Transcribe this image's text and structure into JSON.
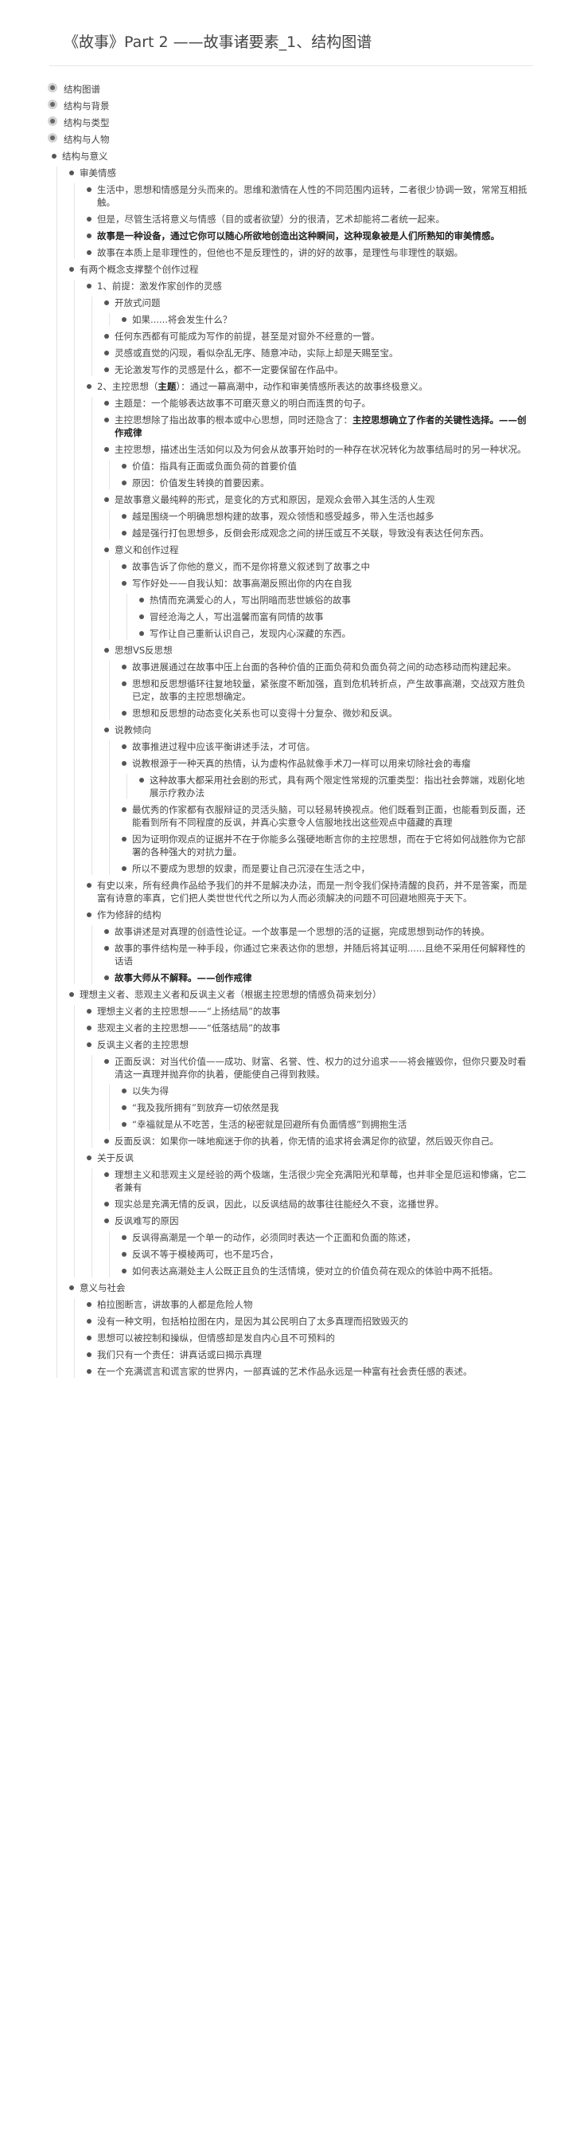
{
  "title": "《故事》Part 2 ——故事诸要素_1、结构图谱",
  "top_items": [
    "结构图谱",
    "结构与背景",
    "结构与类型",
    "结构与人物"
  ],
  "meaning": {
    "label": "结构与意义",
    "aesthetic": {
      "label": "审美情感",
      "items": [
        "生活中，思想和情感是分头而来的。思维和激情在人性的不同范围内运转，二者很少协调一致，常常互相抵触。",
        "但是，尽管生活将意义与情感（目的或者欲望）分的很清，艺术却能将二者统一起来。",
        "故事是一种设备，通过它你可以随心所欲地创造出这种瞬间，这种现象被是人们所熟知的审美情感。",
        "故事在本质上是非理性的，但他也不是反理性的，讲的好的故事，是理性与非理性的联姻。"
      ]
    },
    "two_concepts": {
      "label": "有两个概念支撑整个创作过程",
      "premise": {
        "label": "1、前提：激发作家创作的灵感",
        "open_q": "开放式问题",
        "open_q_sub": "如果......将会发生什么？",
        "items": [
          "任何东西都有可能成为写作的前提，甚至是对窗外不经意的一瞥。",
          "灵感或直觉的闪现，看似杂乱无序、随意冲动，实际上却是天赐至宝。",
          "无论激发写作的灵感是什么，都不一定要保留在作品中。"
        ]
      },
      "controlling": {
        "label_a": "2、主控思想（",
        "label_bold": "主题",
        "label_b": "）：通过一幕高潮中，动作和审美情感所表达的故事终极意义。",
        "p1": "主题是：一个能够表达故事不可磨灭意义的明白而连贯的句子。",
        "p2a": "主控思想除了指出故事的根本或中心思想，同时还隐含了：",
        "p2b": "主控思想确立了作者的关键性选择。——创作戒律",
        "p3": "主控思想，描述出生活如何以及为何会从故事开始时的一种存在状况转化为故事结局时的另一种状况。",
        "p3_sub": [
          "价值：指具有正面或负面负荷的首要价值",
          "原因：价值发生转换的首要因素。"
        ],
        "p4": "是故事意义最纯粹的形式，是变化的方式和原因，是观众会带入其生活的人生观",
        "p4_sub": [
          "越是围绕一个明确思想构建的故事，观众领悟和感受越多，带入生活也越多",
          "越是强行打包思想多，反倒会形成观念之间的拼压或互不关联，导致没有表达任何东西。"
        ],
        "p5": "意义和创作过程",
        "p5_sub": [
          "故事告诉了你他的意义，而不是你将意义叙述到了故事之中",
          "写作好处——自我认知：故事高潮反照出你的内在自我"
        ],
        "p5_sub2": [
          "热情而充满爱心的人，写出阴暗而悲世嫉俗的故事",
          "冒经沧海之人，写出温馨而富有同情的故事",
          "写作让自己重新认识自己，发现内心深藏的东西。"
        ],
        "p6": "思想VS反思想",
        "p6_sub": [
          "故事进展通过在故事中压上台面的各种价值的正面负荷和负面负荷之间的动态移动而构建起来。",
          "思想和反思想循环往复地较量，紧张度不断加强，直到危机转折点，产生故事高潮，交战双方胜负已定，故事的主控思想确定。",
          "思想和反思想的动态变化关系也可以变得十分复杂、微妙和反讽。"
        ],
        "p7": "说教倾向",
        "p7_sub": [
          "故事推进过程中应该平衡讲述手法，才可信。",
          "说教根源于一种天真的热情，认为虚构作品就像手术刀一样可以用来切除社会的毒瘤"
        ],
        "p7_sub2": "这种故事大都采用社会剧的形式，具有两个限定性常规的沉重类型：指出社会弊端，戏剧化地展示疗救办法",
        "p7_sub3": [
          "最优秀的作家都有衣服辩证的灵活头脑，可以轻易转换视点。他们既看到正面，也能看到反面，还能看到所有不同程度的反讽，并真心实意令人信服地找出这些观点中蕴藏的真理",
          "因为证明你观点的证据并不在于你能多么强硬地断言你的主控思想，而在于它将如何战胜你为它部署的各种强大的对抗力量。",
          "所以不要成为思想的奴隶，而是要让自己沉浸在生活之中，"
        ]
      }
    },
    "anxiety": "有史以来，所有经典作品给予我们的并不是解决办法，而是一剂令我们保持清醒的良药，并不是答案，而是富有诗意的率真，它们把人类世世代代之所以为人而必须解决的问题不可回避地照亮于天下。",
    "art": {
      "label": "作为修辞的结构",
      "items": [
        "故事讲述是对真理的创造性论证。一个故事是一个思想的活的证据，完成思想到动作的转换。",
        "故事的事件结构是一种手段，你通过它来表达你的思想，并随后将其证明......且绝不采用任何解释性的话语"
      ],
      "rule": "故事大师从不解释。——创作戒律"
    }
  },
  "idealism": {
    "label": "理想主义者、悲观主义者和反讽主义者（根据主控思想的情感负荷来划分）",
    "items": [
      "理想主义者的主控思想——“上扬结局”的故事",
      "悲观主义者的主控思想——“低落结局”的故事"
    ],
    "ironic": {
      "label": "反讽主义者的主控思想",
      "positive": "正面反讽：对当代价值——成功、财富、名誉、性、权力的过分追求——将会摧毁你，但你只要及时看清这一真理并抛弃你的执着，便能使自己得到救赎。",
      "positive_sub": [
        "以失为得",
        "“我及我所拥有”到放弃一切依然是我",
        "“幸福就是从不吃苦，生活的秘密就是回避所有负面情感”到拥抱生活"
      ],
      "negative": "反面反讽：如果你一味地痴迷于你的执着，你无情的追求将会满足你的欲望，然后毁灭你自己。"
    },
    "about": {
      "label": "关于反讽",
      "items": [
        "理想主义和悲观主义是经验的两个极端，生活很少完全充满阳光和草莓，也并非全是厄运和惨痛，它二者兼有",
        "现实总是充满无情的反讽，因此，以反讽结局的故事往往能经久不衰，迄播世界。"
      ],
      "difficulty": "反讽难写的原因",
      "difficulty_sub": [
        "反讽得高潮是一个单一的动作，必须同时表达一个正面和负面的陈述，",
        "反讽不等于模棱两可，也不是巧合，",
        "如何表达高潮处主人公既正且负的生活情境，使对立的价值负荷在观众的体验中两不抵牾。"
      ]
    }
  },
  "society": {
    "label": "意义与社会",
    "items": [
      "柏拉图断言，讲故事的人都是危险人物",
      "没有一种文明，包括柏拉图在内，是因为其公民明白了太多真理而招致毁灭的",
      "思想可以被控制和操纵，但情感却是发自内心且不可预料的",
      "我们只有一个责任：讲真话或曰揭示真理",
      "在一个充满谎言和谎言家的世界内，一部真诚的艺术作品永远是一种富有社会责任感的表述。"
    ]
  }
}
